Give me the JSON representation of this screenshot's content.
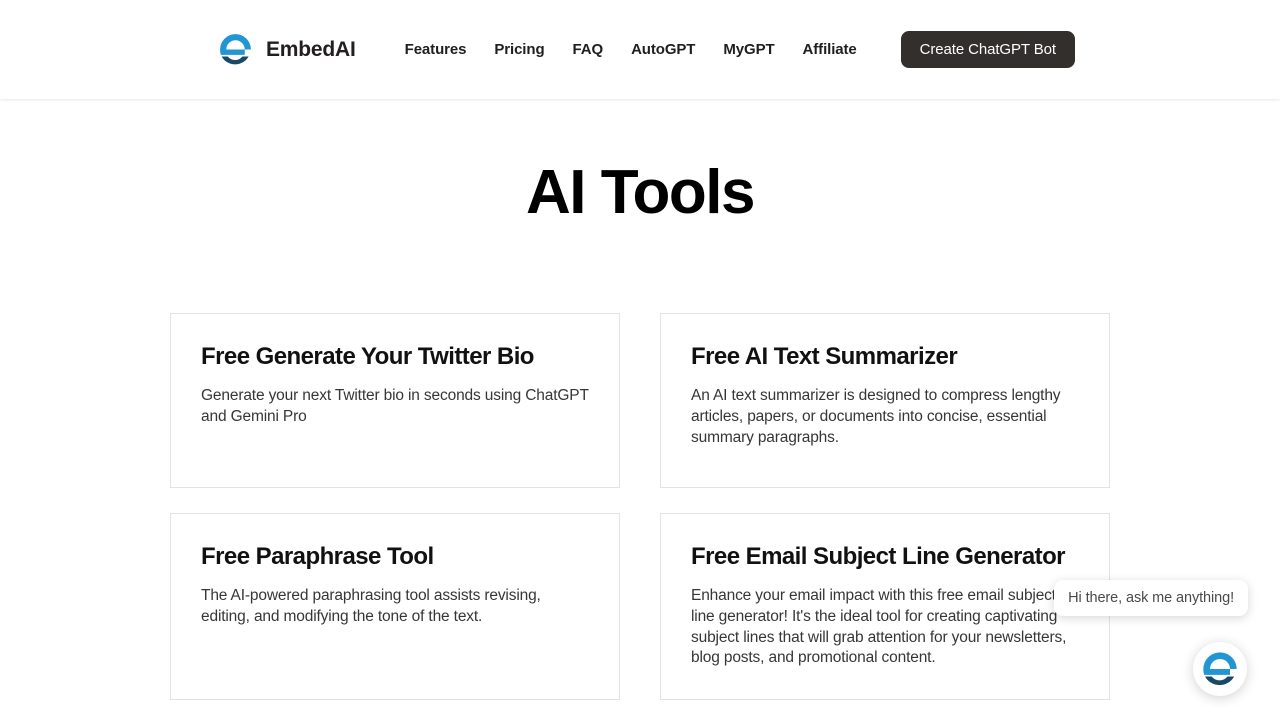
{
  "brand": {
    "name": "EmbedAI",
    "logo_icon": "embedai-e-logo-icon",
    "logo_colors": {
      "top_arc": "#2196d3",
      "bottom_arc": "#1b4965"
    }
  },
  "header": {
    "nav": [
      {
        "label": "Features",
        "name": "nav-link-features"
      },
      {
        "label": "Pricing",
        "name": "nav-link-pricing"
      },
      {
        "label": "FAQ",
        "name": "nav-link-faq"
      },
      {
        "label": "AutoGPT",
        "name": "nav-link-autogpt"
      },
      {
        "label": "MyGPT",
        "name": "nav-link-mygpt"
      },
      {
        "label": "Affiliate",
        "name": "nav-link-affiliate"
      }
    ],
    "cta_label": "Create ChatGPT Bot",
    "cta_bg": "#332f2c"
  },
  "page": {
    "title": "AI Tools"
  },
  "tools": [
    {
      "title": "Free Generate Your Twitter Bio",
      "description": "Generate your next Twitter bio in seconds using ChatGPT and Gemini Pro"
    },
    {
      "title": "Free AI Text Summarizer",
      "description": "An AI text summarizer is designed to compress lengthy articles, papers, or documents into concise, essential summary paragraphs."
    },
    {
      "title": "Free Paraphrase Tool",
      "description": "The AI-powered paraphrasing tool assists revising, editing, and modifying the tone of the text."
    },
    {
      "title": "Free Email Subject Line Generator",
      "description": "Enhance your email impact with this free email subject line generator! It's the ideal tool for creating captivating subject lines that will grab attention for your newsletters, blog posts, and promotional content."
    }
  ],
  "chat_widget": {
    "greeting": "Hi there, ask me anything!",
    "launcher_icon": "embedai-chat-launcher-icon"
  }
}
